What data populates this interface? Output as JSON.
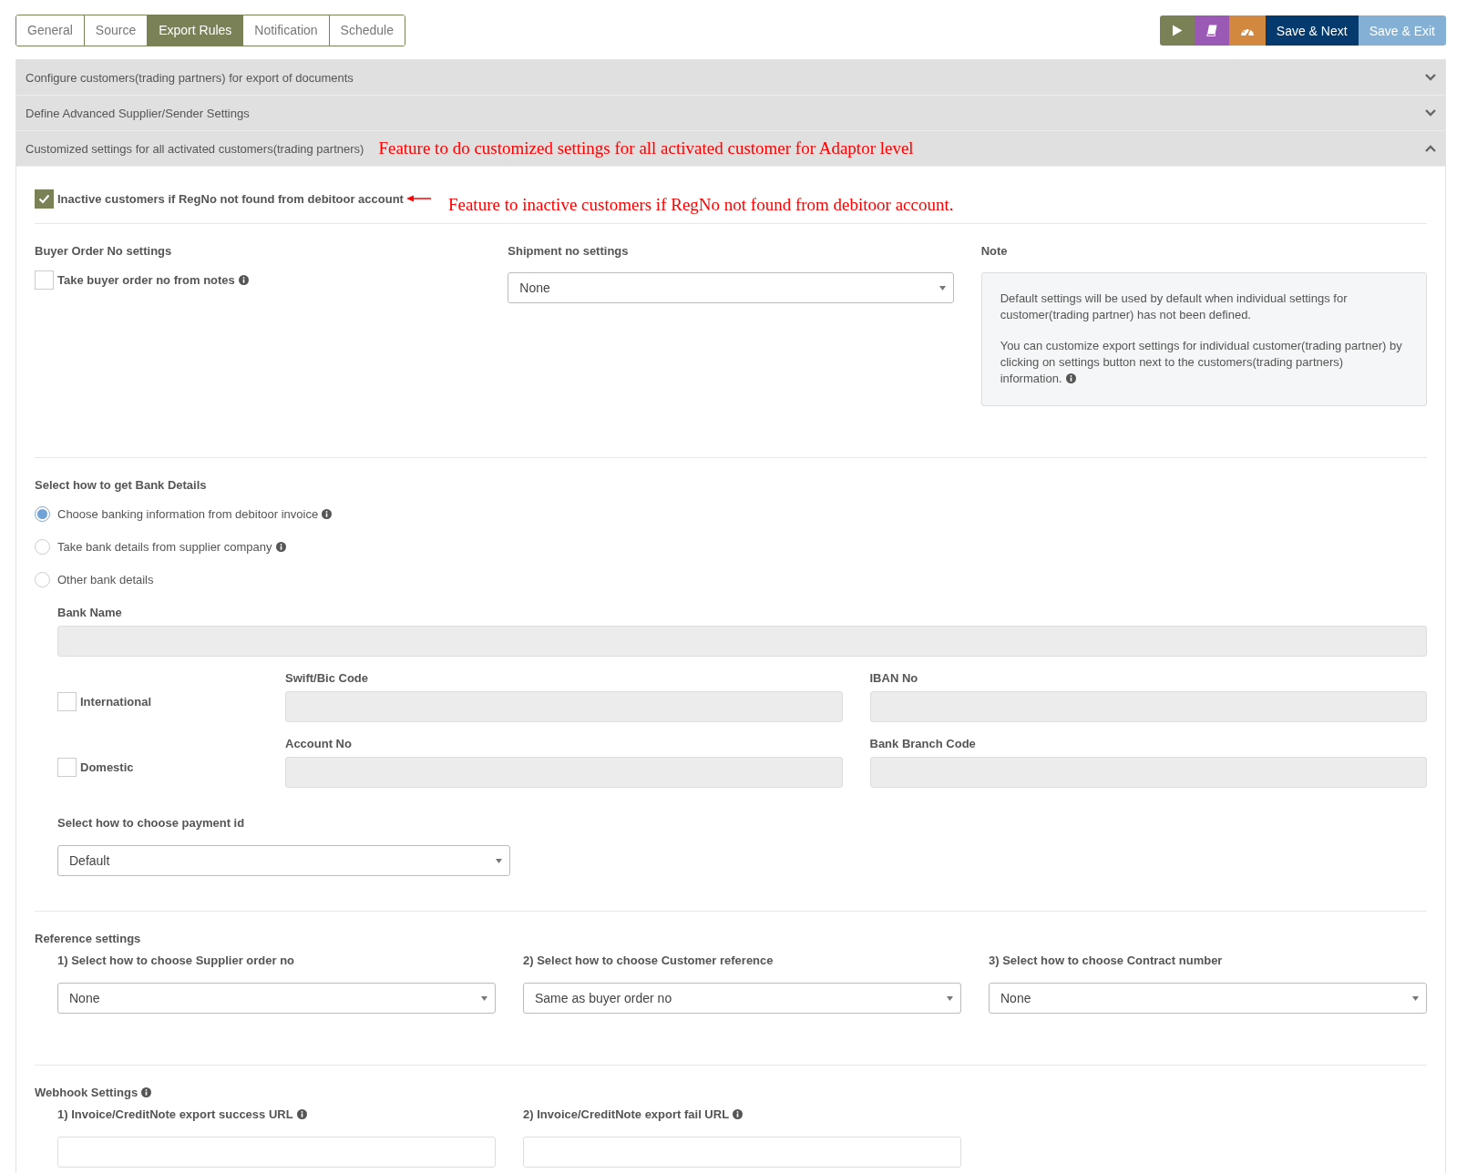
{
  "tabs": [
    {
      "label": "General",
      "selected": false
    },
    {
      "label": "Source",
      "selected": false
    },
    {
      "label": "Export Rules",
      "selected": true
    },
    {
      "label": "Notification",
      "selected": false
    },
    {
      "label": "Schedule",
      "selected": false
    }
  ],
  "toolbar": [
    {
      "kind": "play"
    },
    {
      "kind": "book"
    },
    {
      "kind": "gauge"
    },
    {
      "kind": "primary",
      "label": "Save & Next"
    },
    {
      "kind": "secondary",
      "label": "Save & Exit"
    }
  ],
  "accordion": [
    {
      "title": "Configure customers(trading partners) for export of documents",
      "expanded": false
    },
    {
      "title": "Define Advanced Supplier/Sender Settings",
      "expanded": false
    },
    {
      "title": "Customized settings for all activated customers(trading partners)",
      "expanded": true,
      "annotation": "Feature to do customized settings for all activated customer for Adaptor level"
    }
  ],
  "inactive_option": {
    "label": "Inactive customers if RegNo not found from debitoor account",
    "checked": true,
    "annotation": "Feature to inactive customers if RegNo not found from debitoor account."
  },
  "buyer_order": {
    "heading": "Buyer Order No settings",
    "option": {
      "label": "Take buyer order no from notes",
      "checked": false
    }
  },
  "shipment": {
    "heading": "Shipment no settings",
    "value": "None"
  },
  "note": {
    "heading": "Note",
    "paragraphs": [
      "Default settings will be used by default when individual settings for customer(trading partner) has not been defined.",
      "You can customize export settings for individual customer(trading partner) by clicking on settings button next to the customers(trading partners) information."
    ]
  },
  "bank": {
    "heading": "Select how to get Bank Details",
    "options": [
      {
        "label": "Choose banking information from debitoor invoice",
        "selected": true,
        "info": true
      },
      {
        "label": "Take bank details from supplier company",
        "selected": false,
        "info": true
      },
      {
        "label": "Other bank details",
        "selected": false,
        "info": false
      }
    ],
    "bank_name": {
      "label": "Bank Name",
      "disabled": true
    },
    "rows": [
      {
        "option": {
          "label": "International",
          "checked": false
        },
        "fields": [
          {
            "label": "Swift/Bic Code",
            "disabled": true
          },
          {
            "label": "IBAN No",
            "disabled": true
          }
        ]
      },
      {
        "option": {
          "label": "Domestic",
          "checked": false
        },
        "fields": [
          {
            "label": "Account No",
            "disabled": true
          },
          {
            "label": "Bank Branch Code",
            "disabled": true
          }
        ]
      }
    ],
    "payment_id": {
      "label": "Select how to choose payment id",
      "value": "Default"
    }
  },
  "reference": {
    "heading": "Reference settings",
    "selects": [
      {
        "label": "1) Select how to choose Supplier order no",
        "value": "None"
      },
      {
        "label": "2) Select how to choose Customer reference",
        "value": "Same as buyer order no"
      },
      {
        "label": "3) Select how to choose Contract number",
        "value": "None"
      }
    ]
  },
  "webhook": {
    "heading": "Webhook Settings",
    "fields": [
      {
        "label": "1) Invoice/CreditNote export success URL",
        "disabled": false
      },
      {
        "label": "2) Invoice/CreditNote export fail URL",
        "disabled": false
      }
    ]
  }
}
